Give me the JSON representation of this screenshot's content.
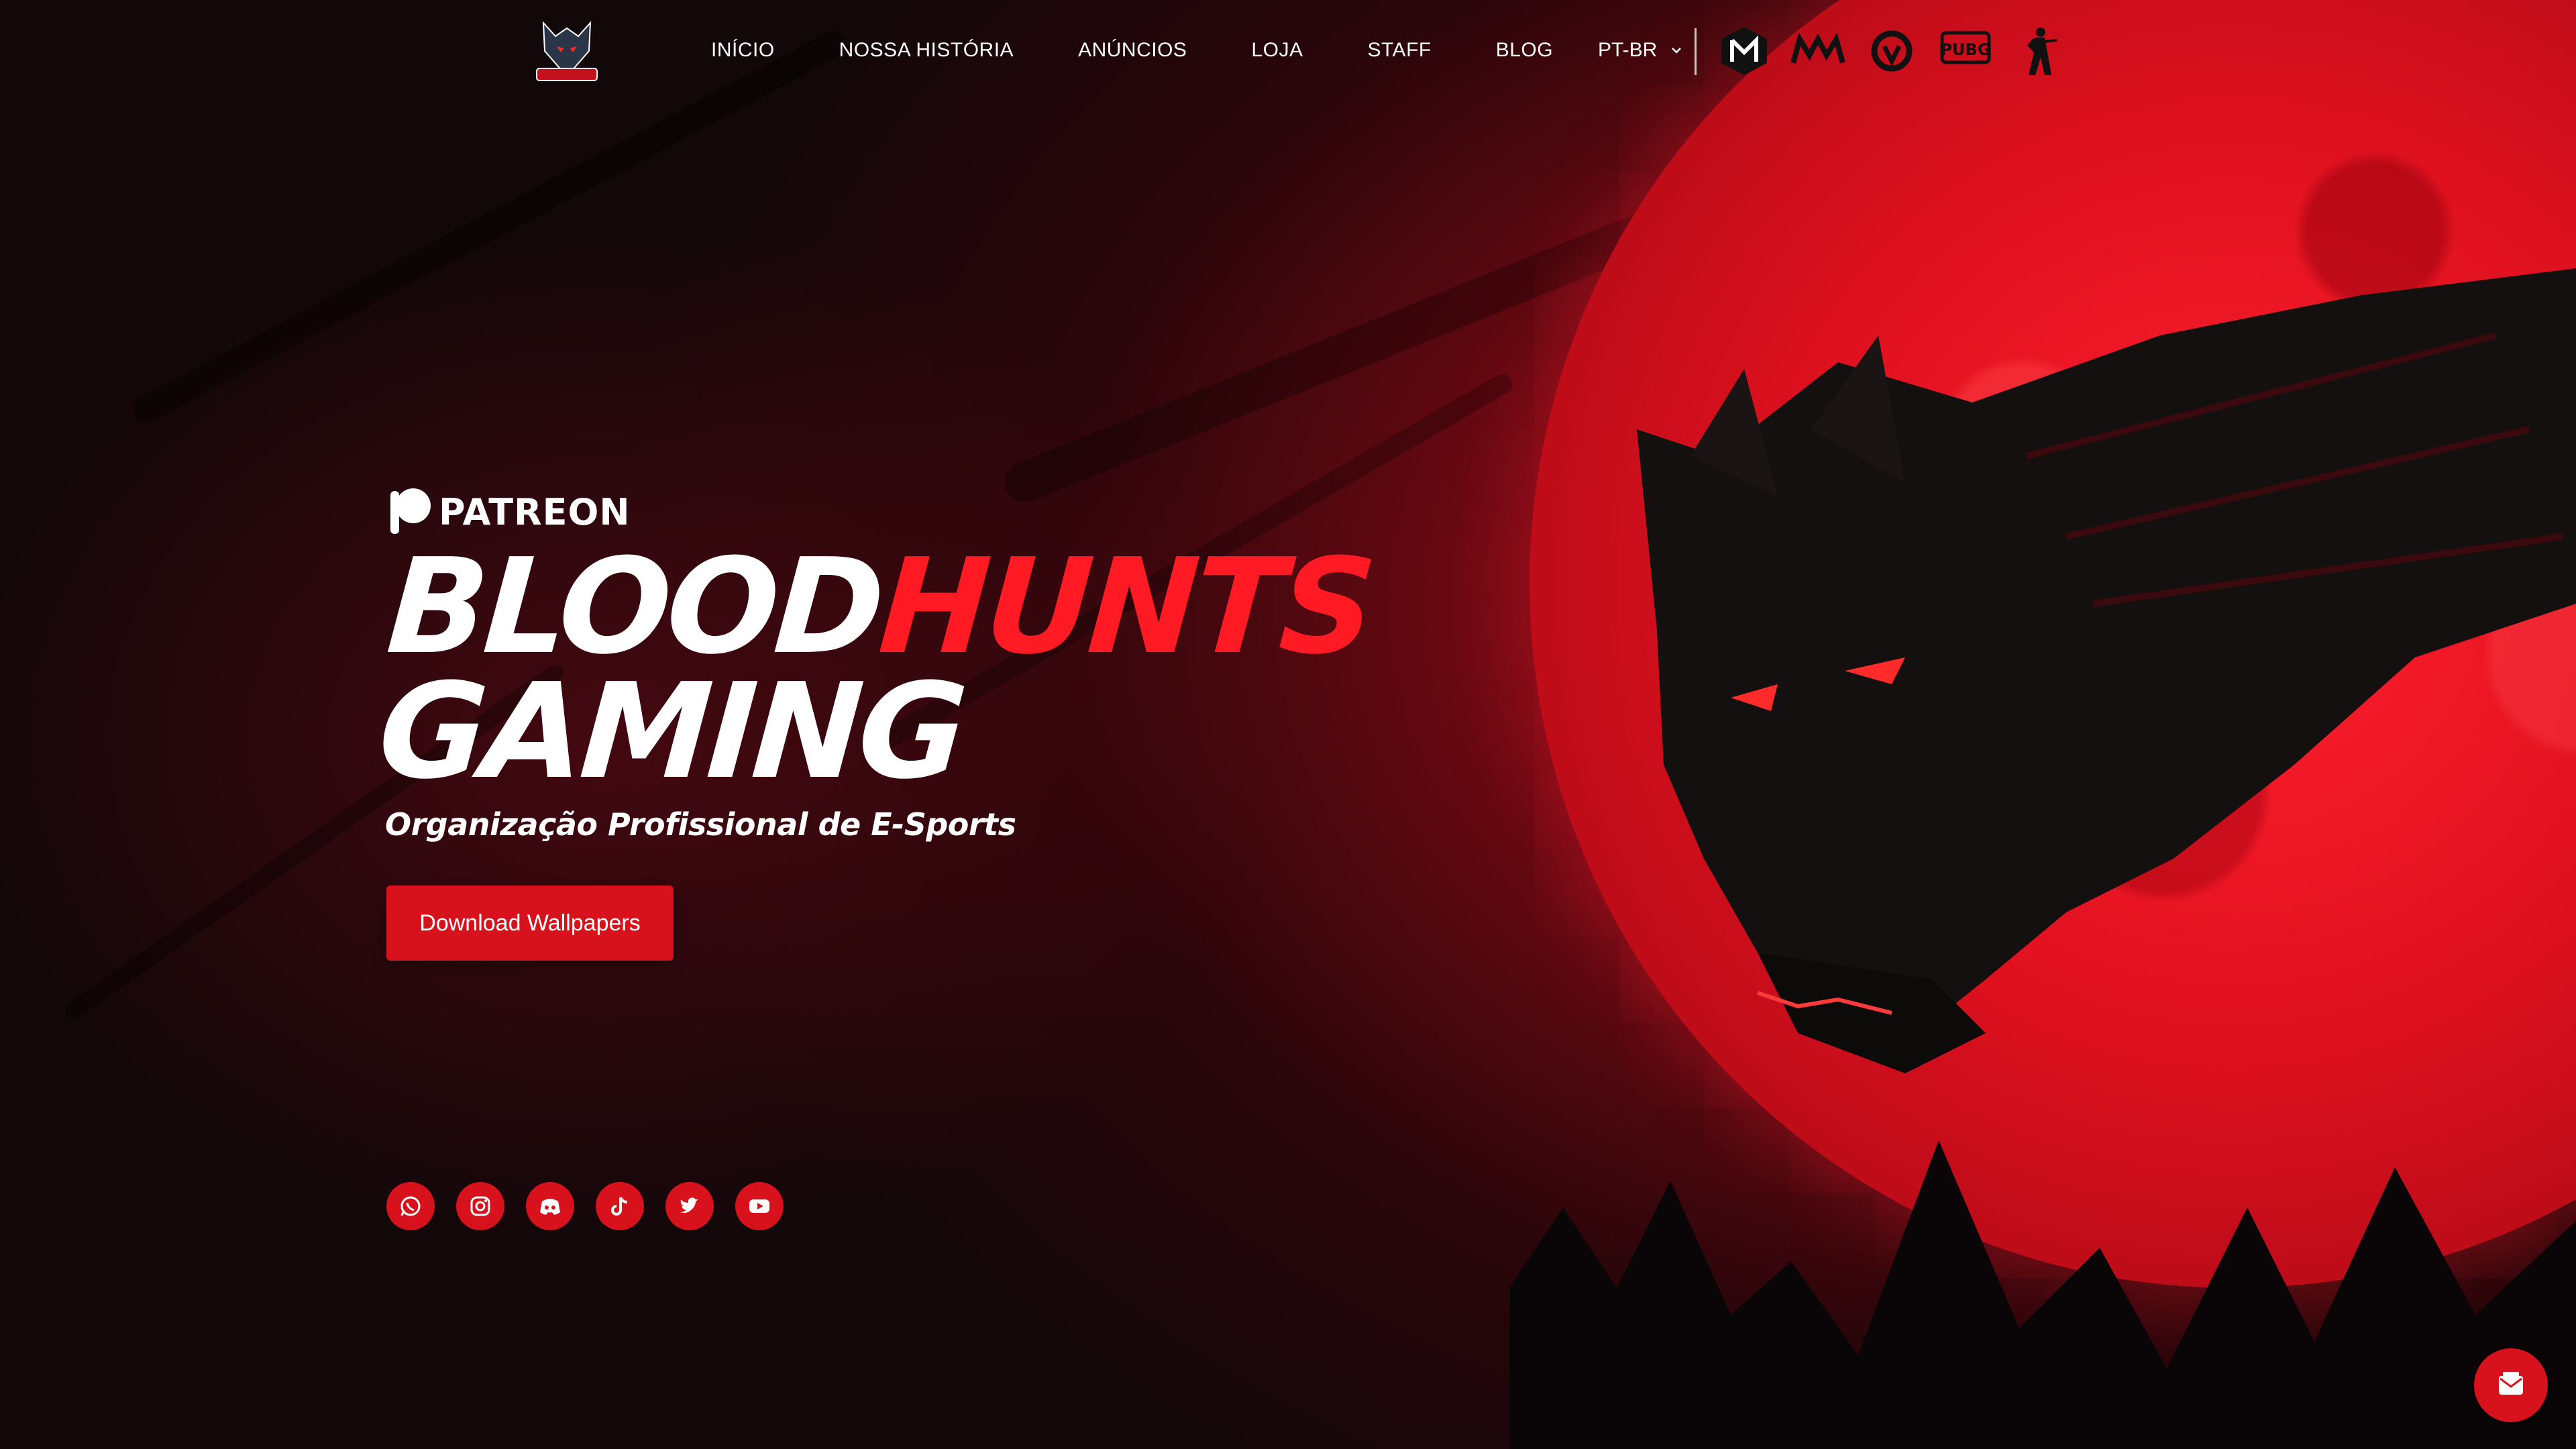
{
  "header": {
    "logo_alt": "BloodHunts",
    "menu": [
      {
        "label": "INÍCIO"
      },
      {
        "label": "NOSSA HISTÓRIA"
      },
      {
        "label": "ANÚNCIOS"
      },
      {
        "label": "LOJA"
      },
      {
        "label": "STAFF"
      },
      {
        "label": "BLOG"
      }
    ],
    "language": "PT-BR",
    "games": [
      {
        "icon": "call-of-duty-icon"
      },
      {
        "icon": "mw-icon"
      },
      {
        "icon": "overwatch-icon"
      },
      {
        "icon": "pubg-mobile-icon",
        "text": "PUBG"
      },
      {
        "icon": "counter-strike-icon"
      }
    ]
  },
  "hero": {
    "patreon_label": "PATREON",
    "title_part1": "BLOOD",
    "title_part2": "HUNTS",
    "title_line2": "GAMING",
    "subtitle": "Organização Profissional de E-Sports",
    "cta_label": "Download Wallpapers"
  },
  "socials": [
    {
      "icon": "whatsapp-icon"
    },
    {
      "icon": "instagram-icon"
    },
    {
      "icon": "discord-icon"
    },
    {
      "icon": "tiktok-icon"
    },
    {
      "icon": "twitter-icon"
    },
    {
      "icon": "youtube-icon"
    }
  ],
  "colors": {
    "accent": "#d8121c",
    "title_red": "#ff1a24",
    "moon": "#e0111f",
    "background": "#120709"
  }
}
